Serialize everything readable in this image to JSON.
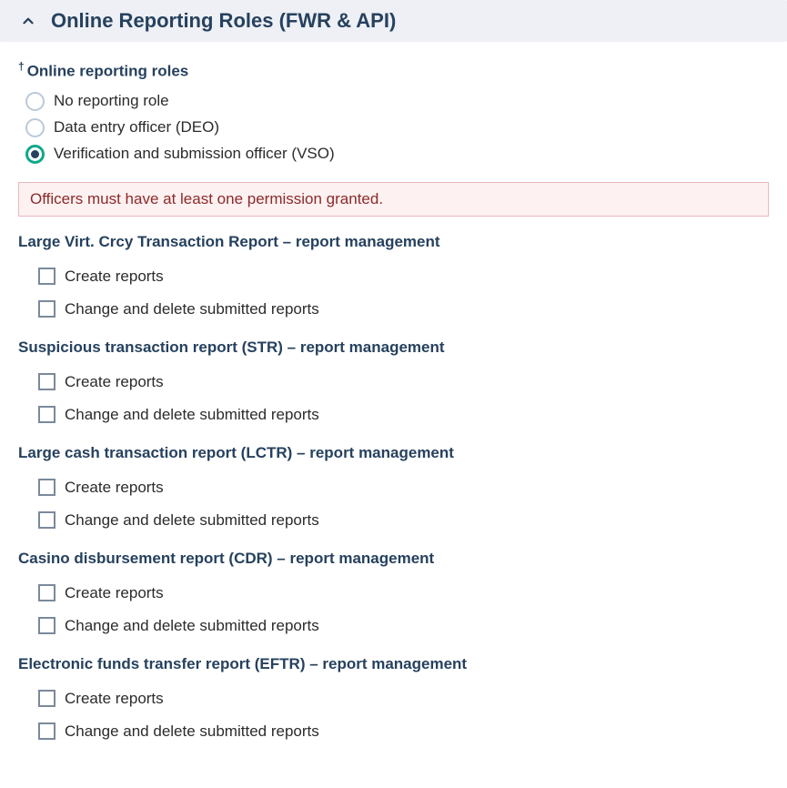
{
  "panel": {
    "title": "Online Reporting Roles (FWR & API)"
  },
  "field": {
    "dagger": "†",
    "label": "Online reporting roles",
    "options": [
      {
        "label": "No reporting role",
        "selected": false
      },
      {
        "label": "Data entry officer (DEO)",
        "selected": false
      },
      {
        "label": "Verification and submission officer (VSO)",
        "selected": true
      }
    ]
  },
  "alert": "Officers must have at least one permission granted.",
  "sections": [
    {
      "title": "Large Virt. Crcy Transaction Report – report management",
      "perms": [
        {
          "label": "Create reports",
          "checked": false
        },
        {
          "label": "Change and delete submitted reports",
          "checked": false
        }
      ]
    },
    {
      "title": "Suspicious transaction report (STR) – report management",
      "perms": [
        {
          "label": "Create reports",
          "checked": false
        },
        {
          "label": "Change and delete submitted reports",
          "checked": false
        }
      ]
    },
    {
      "title": "Large cash transaction report (LCTR) – report management",
      "perms": [
        {
          "label": "Create reports",
          "checked": false
        },
        {
          "label": "Change and delete submitted reports",
          "checked": false
        }
      ]
    },
    {
      "title": "Casino disbursement report (CDR) – report management",
      "perms": [
        {
          "label": "Create reports",
          "checked": false
        },
        {
          "label": "Change and delete submitted reports",
          "checked": false
        }
      ]
    },
    {
      "title": "Electronic funds transfer report (EFTR) – report management",
      "perms": [
        {
          "label": "Create reports",
          "checked": false
        },
        {
          "label": "Change and delete submitted reports",
          "checked": false
        }
      ]
    }
  ]
}
